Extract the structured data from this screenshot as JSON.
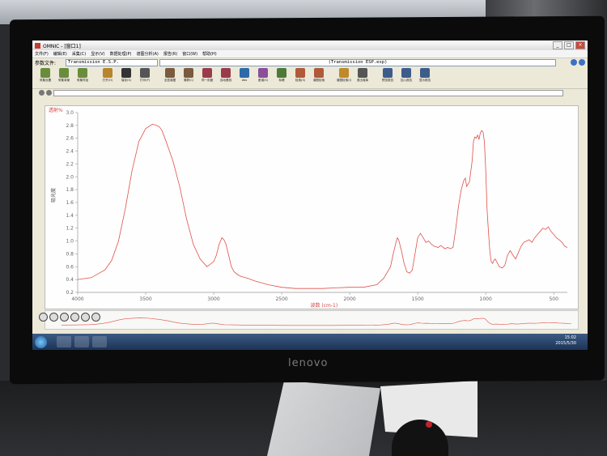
{
  "window": {
    "title": "OMNIC - [窗口1]",
    "controls": [
      "_",
      "□",
      "×"
    ]
  },
  "menu": [
    "文件(F)",
    "编辑(E)",
    "采集(C)",
    "显示(V)",
    "数据处理(P)",
    "谱图分析(A)",
    "报告(R)",
    "窗口(W)",
    "帮助(H)"
  ],
  "file": {
    "label": "参数文件:",
    "name": "Transmission E.S.P.",
    "experiment": "(Transmission ESP.exp)"
  },
  "toolbar": [
    {
      "label": "采集设置",
      "icon": "collect-setup-icon",
      "color": "#6a8d3c"
    },
    {
      "label": "采集背景",
      "icon": "collect-background-icon",
      "color": "#6a8d3c"
    },
    {
      "label": "采集样品",
      "icon": "collect-sample-icon",
      "color": "#6a8d3c"
    },
    {
      "label": "打开(O)",
      "icon": "open-icon",
      "color": "#b9852a"
    },
    {
      "label": "保存(S)",
      "icon": "save-icon",
      "color": "#333333"
    },
    {
      "label": "打印(P)",
      "icon": "print-icon",
      "color": "#555555"
    },
    {
      "label": "全显谱图",
      "icon": "full-scale-icon",
      "color": "#7a5b3d"
    },
    {
      "label": "清屏(C)",
      "icon": "clear-icon",
      "color": "#7a5b3d"
    },
    {
      "label": "同一刻度",
      "icon": "common-scale-icon",
      "color": "#9a3b4a"
    },
    {
      "label": "自动基线",
      "icon": "auto-baseline-icon",
      "color": "#9a3b4a"
    },
    {
      "label": "Abs",
      "icon": "absorbance-icon",
      "color": "#2d6aa8"
    },
    {
      "label": "差谱(S)",
      "icon": "subtract-icon",
      "color": "#8a4e9a"
    },
    {
      "label": "标峰",
      "icon": "peak-label-icon",
      "color": "#4d7a3a"
    },
    {
      "label": "检索(S)",
      "icon": "search-library-icon",
      "color": "#b05a3a"
    },
    {
      "label": "谱图检索",
      "icon": "spectrum-search-icon",
      "color": "#b05a3a"
    },
    {
      "label": "谱图检索(I)",
      "icon": "magnify-icon",
      "color": "#c08a2b"
    },
    {
      "label": "退出谱库",
      "icon": "exit-library-icon",
      "color": "#555555"
    },
    {
      "label": "预览报告",
      "icon": "preview-report-icon",
      "color": "#3c5c8a"
    },
    {
      "label": "加入报告",
      "icon": "add-report-icon",
      "color": "#3c5c8a"
    },
    {
      "label": "显示报告",
      "icon": "show-report-icon",
      "color": "#3c5c8a"
    }
  ],
  "spectrum_label": "透射%",
  "taskbar": {
    "time": "15:02",
    "date": "2015/5/30"
  },
  "monitor_brand": "lenovo",
  "chart_data": {
    "type": "line",
    "title": "",
    "xlabel": "波数 (cm-1)",
    "ylabel": "吸光度",
    "xlim": [
      4000,
      400
    ],
    "ylim": [
      0.2,
      3.0
    ],
    "xticks": [
      4000,
      3500,
      3000,
      2500,
      2000,
      1500,
      1000,
      500
    ],
    "yticks": [
      0.2,
      0.4,
      0.6,
      0.8,
      1.0,
      1.2,
      1.4,
      1.6,
      1.8,
      2.0,
      2.2,
      2.4,
      2.6,
      2.8,
      3.0
    ],
    "color": "#e0504a",
    "series": [
      {
        "x": [
          4000,
          3900,
          3800,
          3750,
          3700,
          3650,
          3600,
          3550,
          3500,
          3450,
          3420,
          3400,
          3380,
          3350,
          3300,
          3250,
          3200,
          3150,
          3100,
          3050,
          3000,
          2980,
          2960,
          2940,
          2925,
          2910,
          2890,
          2870,
          2850,
          2820,
          2800,
          2750,
          2700,
          2600,
          2500,
          2400,
          2300,
          2200,
          2100,
          2000,
          1900,
          1800,
          1750,
          1700,
          1680,
          1660,
          1650,
          1640,
          1620,
          1600,
          1580,
          1560,
          1540,
          1520,
          1500,
          1480,
          1460,
          1440,
          1420,
          1400,
          1380,
          1350,
          1330,
          1300,
          1280,
          1260,
          1240,
          1220,
          1200,
          1180,
          1160,
          1150,
          1140,
          1120,
          1100,
          1090,
          1080,
          1070,
          1060,
          1050,
          1040,
          1030,
          1020,
          1010,
          1000,
          990,
          980,
          970,
          960,
          950,
          940,
          930,
          920,
          900,
          880,
          860,
          840,
          820,
          800,
          780,
          760,
          740,
          720,
          700,
          680,
          660,
          640,
          620,
          600,
          580,
          560,
          540,
          520,
          500,
          480,
          460,
          440,
          420,
          400
        ],
        "y": [
          0.4,
          0.43,
          0.55,
          0.7,
          1.0,
          1.5,
          2.1,
          2.55,
          2.75,
          2.82,
          2.8,
          2.78,
          2.72,
          2.55,
          2.25,
          1.85,
          1.35,
          0.95,
          0.72,
          0.6,
          0.68,
          0.78,
          0.95,
          1.05,
          1.02,
          0.95,
          0.78,
          0.6,
          0.52,
          0.47,
          0.45,
          0.42,
          0.38,
          0.32,
          0.28,
          0.26,
          0.26,
          0.26,
          0.27,
          0.28,
          0.28,
          0.32,
          0.42,
          0.6,
          0.8,
          0.98,
          1.05,
          1.02,
          0.85,
          0.65,
          0.52,
          0.5,
          0.55,
          0.8,
          1.05,
          1.12,
          1.05,
          0.98,
          1.0,
          0.95,
          0.92,
          0.9,
          0.93,
          0.88,
          0.9,
          0.88,
          0.9,
          1.2,
          1.55,
          1.8,
          1.95,
          1.98,
          1.85,
          1.92,
          2.25,
          2.55,
          2.62,
          2.6,
          2.65,
          2.58,
          2.68,
          2.72,
          2.7,
          2.55,
          2.1,
          1.5,
          1.15,
          0.85,
          0.68,
          0.65,
          0.7,
          0.72,
          0.68,
          0.6,
          0.58,
          0.62,
          0.78,
          0.85,
          0.78,
          0.72,
          0.82,
          0.92,
          0.98,
          1.0,
          1.02,
          0.98,
          1.05,
          1.1,
          1.15,
          1.2,
          1.18,
          1.22,
          1.15,
          1.1,
          1.05,
          1.02,
          0.98,
          0.92,
          0.9
        ]
      }
    ]
  }
}
